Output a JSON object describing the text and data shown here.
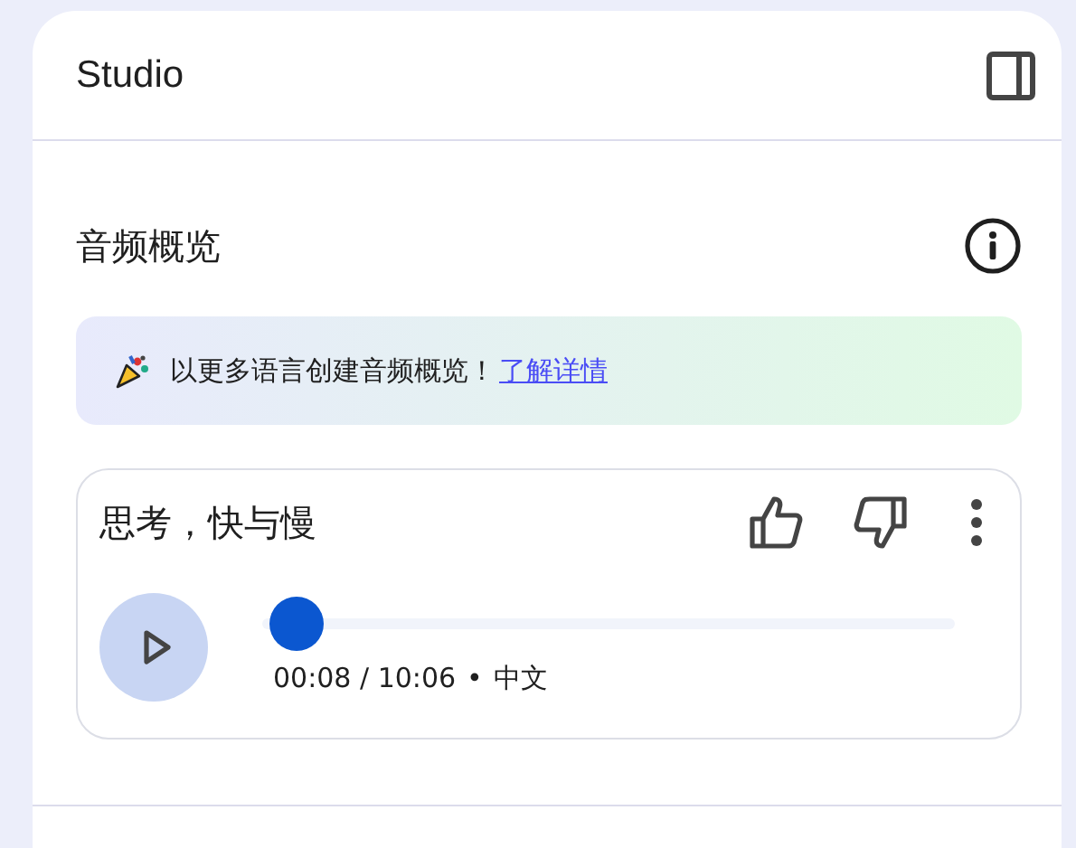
{
  "panel": {
    "title": "Studio"
  },
  "section": {
    "title": "音频概览"
  },
  "banner": {
    "text": "以更多语言创建音频概览！",
    "link": "了解详情"
  },
  "audio_card": {
    "title": "思考，快与慢",
    "player": {
      "level": 0.013,
      "time": "00:08 / 10:06",
      "separator": "•",
      "language": "中文"
    }
  }
}
